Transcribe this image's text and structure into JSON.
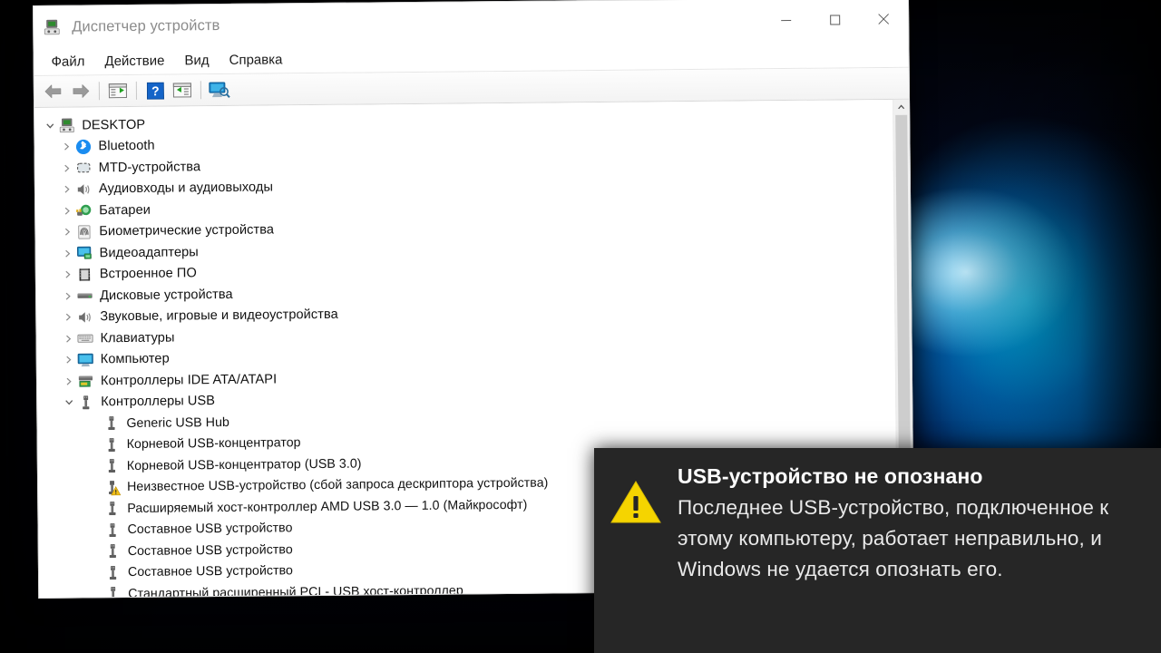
{
  "window": {
    "title": "Диспетчер устройств",
    "icon": "device-manager-icon",
    "controls": {
      "minimize": "minimize-icon",
      "maximize": "maximize-icon",
      "close": "close-icon"
    }
  },
  "menubar": {
    "items": [
      {
        "label": "Файл"
      },
      {
        "label": "Действие"
      },
      {
        "label": "Вид"
      },
      {
        "label": "Справка"
      }
    ]
  },
  "toolbar": {
    "buttons": [
      {
        "name": "back-button",
        "icon": "arrow-left-icon"
      },
      {
        "name": "forward-button",
        "icon": "arrow-right-icon"
      },
      {
        "name": "properties-button",
        "icon": "properties-icon"
      },
      {
        "name": "help-button",
        "icon": "help-icon"
      },
      {
        "name": "update-driver-button",
        "icon": "update-driver-icon"
      },
      {
        "name": "scan-hardware-button",
        "icon": "scan-hardware-icon"
      }
    ]
  },
  "tree": {
    "root": {
      "label": "DESKTOP",
      "icon": "computer-icon",
      "expanded": true
    },
    "categories": [
      {
        "label": "Bluetooth",
        "icon": "bluetooth-icon",
        "expanded": false
      },
      {
        "label": "MTD-устройства",
        "icon": "mtd-icon",
        "expanded": false
      },
      {
        "label": "Аудиовходы и аудиовыходы",
        "icon": "speaker-icon",
        "expanded": false
      },
      {
        "label": "Батареи",
        "icon": "battery-icon",
        "expanded": false
      },
      {
        "label": "Биометрические устройства",
        "icon": "fingerprint-icon",
        "expanded": false
      },
      {
        "label": "Видеоадаптеры",
        "icon": "display-adapter-icon",
        "expanded": false
      },
      {
        "label": "Встроенное ПО",
        "icon": "firmware-icon",
        "expanded": false
      },
      {
        "label": "Дисковые устройства",
        "icon": "disk-drive-icon",
        "expanded": false
      },
      {
        "label": "Звуковые, игровые и видеоустройства",
        "icon": "speaker-icon",
        "expanded": false
      },
      {
        "label": "Клавиатуры",
        "icon": "keyboard-icon",
        "expanded": false
      },
      {
        "label": "Компьютер",
        "icon": "monitor-icon",
        "expanded": false
      },
      {
        "label": "Контроллеры IDE ATA/ATAPI",
        "icon": "ide-controller-icon",
        "expanded": false
      },
      {
        "label": "Контроллеры USB",
        "icon": "usb-icon",
        "expanded": true
      }
    ],
    "usb_devices": [
      {
        "label": "Generic USB Hub",
        "icon": "usb-icon",
        "warning": false
      },
      {
        "label": "Корневой USB-концентратор",
        "icon": "usb-icon",
        "warning": false
      },
      {
        "label": "Корневой USB-концентратор (USB 3.0)",
        "icon": "usb-icon",
        "warning": false
      },
      {
        "label": "Неизвестное USB-устройство (сбой запроса дескриптора устройства)",
        "icon": "usb-icon",
        "warning": true
      },
      {
        "label": "Расширяемый хост-контроллер AMD USB 3.0 — 1.0 (Майкрософт)",
        "icon": "usb-icon",
        "warning": false
      },
      {
        "label": "Составное USB устройство",
        "icon": "usb-icon",
        "warning": false
      },
      {
        "label": "Составное USB устройство",
        "icon": "usb-icon",
        "warning": false
      },
      {
        "label": "Составное USB устройство",
        "icon": "usb-icon",
        "warning": false
      },
      {
        "label": "Стандартный расширенный PCI - USB хост-контроллер",
        "icon": "usb-icon",
        "warning": false
      }
    ]
  },
  "scrollbar": {
    "up_arrow": "chevron-up-icon",
    "down_arrow": "chevron-down-icon"
  },
  "notification": {
    "icon": "warning-triangle-icon",
    "title": "USB-устройство не опознано",
    "message": "Последнее USB-устройство, подключенное к этому компьютеру, работает неправильно, и Windows не удается опознать его."
  },
  "colors": {
    "warning_yellow": "#f5d400",
    "bluetooth_blue": "#1a8cf0",
    "toast_background": "#262626",
    "window_background": "#ffffff",
    "desktop_accent": "#00a8e8"
  }
}
